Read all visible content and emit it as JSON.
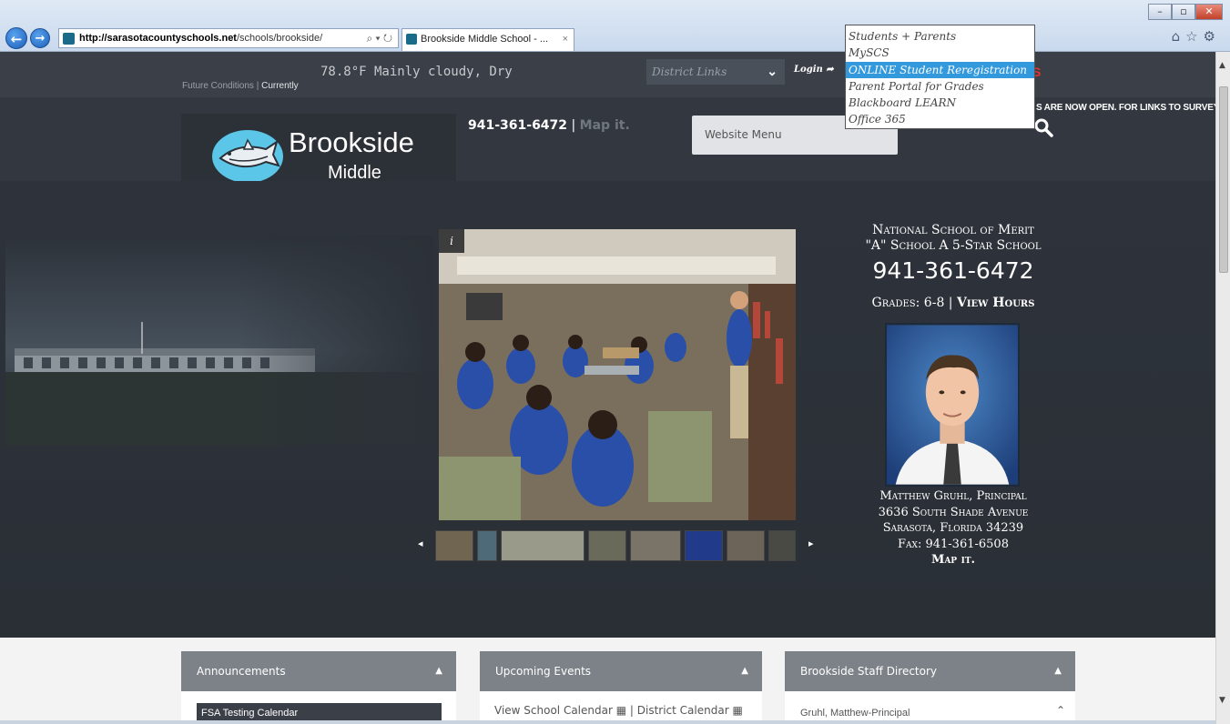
{
  "browser": {
    "url_domain": "http://sarasotacountyschools.net",
    "url_path": "/schools/brookside/",
    "address_controls": "⌕ ▾ ↻",
    "tab_title": "Brookside Middle School - ...",
    "tab_close": "×",
    "window_controls": [
      "–",
      "▫",
      "✕"
    ],
    "toolbar_icons": "⌂☆⚙"
  },
  "topbar": {
    "weather_temp": "78.8°F Mainly cloudy, Dry",
    "weather_tab_future": "Future Conditions",
    "weather_tab_sep": "|",
    "weather_tab_current": "Currently",
    "district_links_label": "District Links",
    "login_label": "Login ➦",
    "red_fragment": "S"
  },
  "dropdown": {
    "items": [
      "Students + Parents",
      "MySCS",
      "ONLINE Student Reregistration",
      "Parent Portal for Grades",
      "Blackboard LEARN",
      "Office 365"
    ],
    "highlighted_index": 2
  },
  "header": {
    "logo_name": "Brookside",
    "logo_sub": "Middle",
    "phone": "941-361-6472",
    "phone_sep": " | ",
    "map_link": "Map it.",
    "menu_button": "Website Menu",
    "ticker": "S ARE NOW OPEN. FOR LINKS TO SURVEYS C"
  },
  "info": {
    "merit": "National School of Merit",
    "grade_line": "\"A\" School A 5-Star School",
    "phone": "941-361-6472",
    "grades_label": "Grades: 6-8",
    "grades_sep": " | ",
    "view_hours": "View Hours",
    "principal": "Matthew Gruhl, Principal",
    "street": "3636 South Shade Avenue",
    "city": "Sarasota, Florida 34239",
    "fax": "Fax: 941-361-6508",
    "map_it": "Map it."
  },
  "slideshow": {
    "info_label": "i",
    "prev": "◂",
    "next": "▸",
    "thumb_colors": [
      "#6f6550",
      "#4e6a78",
      "#9a9a8a",
      "#6a6a5a",
      "#7a7468",
      "#223a8a",
      "#6c6458",
      "#4a4a44"
    ]
  },
  "panels": {
    "announcements": {
      "title": "Announcements",
      "item": "FSA Testing Calendar"
    },
    "events": {
      "title": "Upcoming Events",
      "link1": "View School Calendar",
      "sep": " | ",
      "link2": "District Calendar"
    },
    "staff": {
      "title": "Brookside Staff Directory",
      "item": "Gruhl, Matthew-Principal"
    },
    "collapse_symbol": "▲"
  },
  "colors": {
    "topbar_bg": "#3b4048",
    "header_bg": "#333840",
    "hero_bg": "#2b2f36",
    "panel_head": "#7d8289",
    "dropdown_highlight": "#3399dd",
    "red_accent": "#e8312f"
  }
}
